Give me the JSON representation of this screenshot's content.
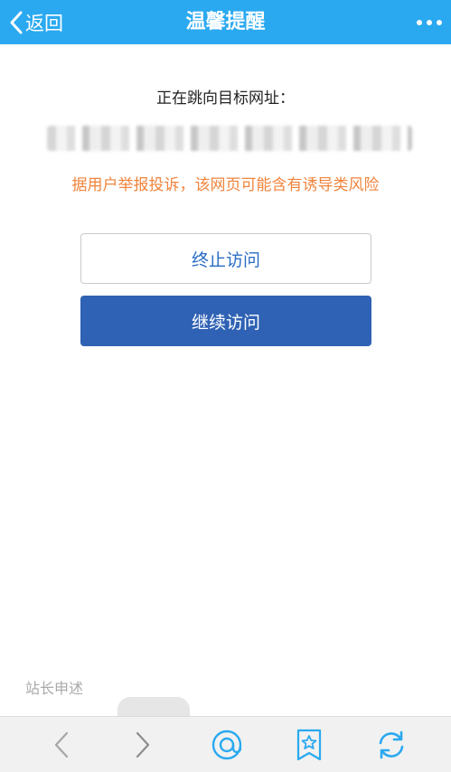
{
  "header": {
    "back_label": "返回",
    "title": "温馨提醒",
    "more_icon": "more-dots-icon"
  },
  "main": {
    "redirect_label": "正在跳向目标网址：",
    "warning_text": "据用户举报投诉，该网页可能含有诱导类风险",
    "stop_button_label": "终止访问",
    "continue_button_label": "继续访问"
  },
  "footer": {
    "site_owner_link": "站长申述"
  },
  "toolbar": {
    "items": [
      "back-arrow-icon",
      "forward-arrow-icon",
      "at-sign-icon",
      "bookmark-star-icon",
      "refresh-icon"
    ]
  },
  "colors": {
    "header_bg": "#2aa9f0",
    "warning": "#f0843c",
    "continue_button": "#2f62b4",
    "stop_button_text": "#2a6cc4"
  }
}
